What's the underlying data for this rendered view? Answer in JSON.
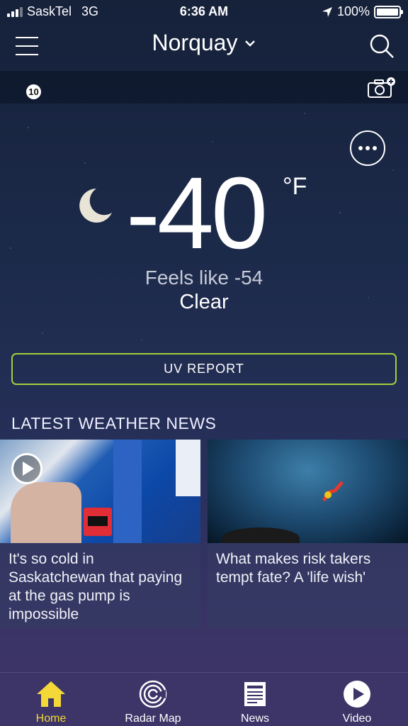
{
  "status_bar": {
    "carrier": "SaskTel",
    "network": "3G",
    "time": "6:36 AM",
    "battery": "100%",
    "battery_level": 1.0
  },
  "header": {
    "location": "Norquay"
  },
  "alert_bar": {
    "badge_count": "10"
  },
  "weather": {
    "temperature": "-40",
    "unit": "°F",
    "feels_like": "Feels like -54",
    "condition": "Clear"
  },
  "uv_button": {
    "label": "UV REPORT"
  },
  "news": {
    "heading": "LATEST WEATHER NEWS",
    "items": [
      {
        "title": "It's so cold in Saskatchewan that paying at the gas pump is impossible",
        "has_video": true
      },
      {
        "title": "What makes risk takers tempt fate? A 'life wish'",
        "has_video": false
      }
    ]
  },
  "tab_bar": {
    "tabs": [
      {
        "label": "Home",
        "icon": "home-icon",
        "active": true
      },
      {
        "label": "Radar Map",
        "icon": "radar-icon",
        "active": false
      },
      {
        "label": "News",
        "icon": "newspaper-icon",
        "active": false
      },
      {
        "label": "Video",
        "icon": "play-icon",
        "active": false
      }
    ]
  },
  "colors": {
    "accent_active_tab": "#f3d838",
    "uv_border": "#a3cf3c",
    "tab_bar_bg": "#3d3468"
  }
}
